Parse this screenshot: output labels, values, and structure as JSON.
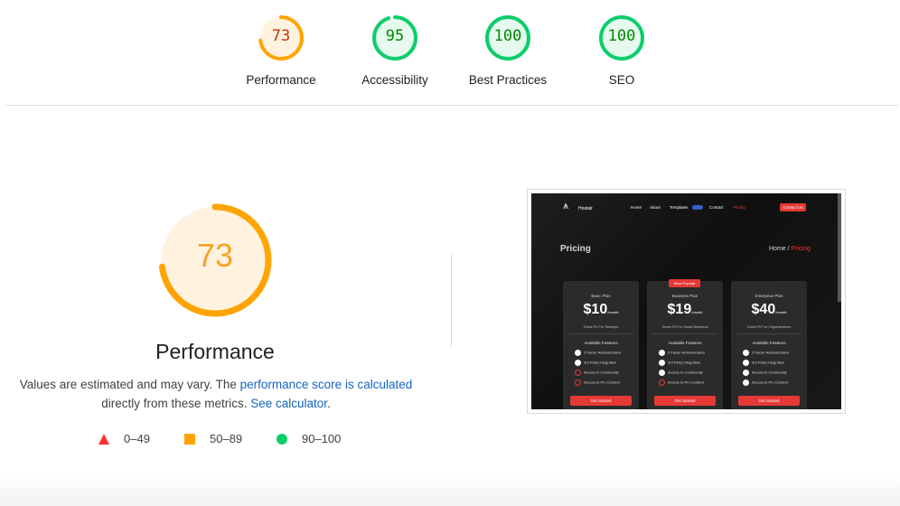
{
  "colors": {
    "fail": "#ff3333",
    "average": "#ffa400",
    "pass": "#0cce6b"
  },
  "categories": [
    {
      "name": "Performance",
      "score": "73",
      "status": "average"
    },
    {
      "name": "Accessibility",
      "score": "95",
      "status": "pass"
    },
    {
      "name": "Best Practices",
      "score": "100",
      "status": "pass"
    },
    {
      "name": "SEO",
      "score": "100",
      "status": "pass"
    }
  ],
  "performance": {
    "score": "73",
    "title": "Performance",
    "desc_prefix": "Values are estimated and may vary. The ",
    "desc_link1": "performance score is calculated",
    "desc_middle": " directly from these metrics. ",
    "desc_link2": "See calculator",
    "desc_suffix": "."
  },
  "legend": [
    {
      "shape": "triangle-icon",
      "range": "0–49"
    },
    {
      "shape": "square-icon",
      "range": "50–89"
    },
    {
      "shape": "circle-icon",
      "range": "90–100"
    }
  ],
  "screenshot": {
    "brand": "Hostair",
    "nav": [
      "Home",
      "About",
      "Templates",
      "Contact",
      "Pricing"
    ],
    "contact_button": "Contact Us",
    "page_title": "Pricing",
    "breadcrumb_home": "Home",
    "breadcrumb_sep": " / ",
    "breadcrumb_current": "Pricing",
    "popular_badge": "Most Popular",
    "plans": [
      {
        "name": "Basic Plan",
        "price": "$10",
        "per": "/month",
        "sub": "Great Fit For Startups"
      },
      {
        "name": "Business Plan",
        "price": "$19",
        "per": "/month",
        "sub": "Great Fit For Small Business"
      },
      {
        "name": "Enterprise Plan",
        "price": "$40",
        "per": "/month",
        "sub": "Great Fit For Organizations"
      }
    ],
    "features_heading": "Available Features",
    "features": [
      "2 Factor Authentication",
      "3rd Party Integration",
      "Access to Community",
      "Access to Pro Content"
    ],
    "cta": "Get Started"
  }
}
